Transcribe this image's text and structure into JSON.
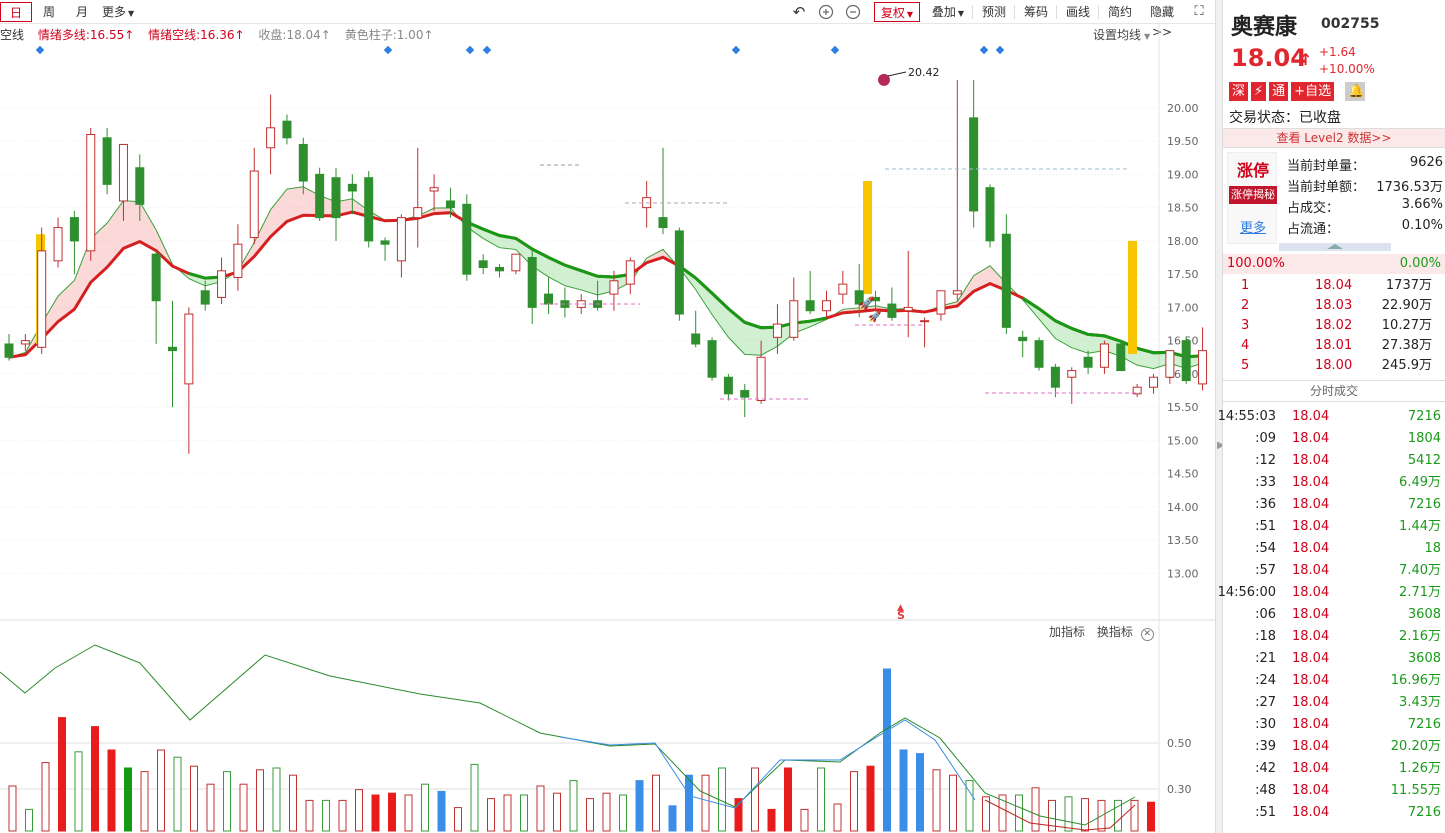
{
  "toolbar": {
    "period_tabs": [
      "日",
      "周",
      "月"
    ],
    "more_label": "更多",
    "right_items": [
      {
        "label": "复权",
        "dropdown": true,
        "highlight": true
      },
      {
        "label": "叠加",
        "dropdown": true
      },
      {
        "label": "预测"
      },
      {
        "label": "筹码"
      },
      {
        "label": "画线"
      },
      {
        "label": "简约"
      },
      {
        "label": "隐藏>>"
      }
    ],
    "icons": [
      "undo-icon",
      "zoom-in-icon",
      "zoom-out-icon",
      "fullscreen-icon"
    ]
  },
  "indicator_header": {
    "items": [
      {
        "text": "空线",
        "color": "#333333"
      },
      {
        "text": "情绪多线:16.55↑",
        "color": "#d0021b"
      },
      {
        "text": "情绪空线:16.36↑",
        "color": "#d0021b"
      },
      {
        "text": "收盘:18.04↑",
        "color": "#888888"
      },
      {
        "text": "黄色柱子:1.00↑",
        "color": "#888888"
      }
    ],
    "set_ma_label": "设置均线"
  },
  "sub_panel": {
    "add_indicator": "加指标",
    "switch_indicator": "换指标"
  },
  "stock": {
    "name": "奥赛康",
    "code": "002755",
    "price": "18.04",
    "change": "+1.64",
    "change_pct": "+10.00%",
    "badges": [
      "深",
      "⚡",
      "通",
      "+自选"
    ],
    "trade_state": "交易状态：已收盘",
    "level2": "查看 Level2 数据>>"
  },
  "limit_up": {
    "title": "涨停",
    "tag": "涨停揭秘",
    "more": "更多",
    "rows": [
      {
        "label": "当前封单量：",
        "value": "9626"
      },
      {
        "label": "当前封单额：",
        "value": "1736.53万"
      },
      {
        "label": "占成交：",
        "value": "3.66%"
      },
      {
        "label": "占流通：",
        "value": "0.10%"
      }
    ]
  },
  "order_book": {
    "left_pct": "100.00%",
    "right_pct": "0.00%",
    "levels": [
      {
        "level": "1",
        "price": "18.04",
        "volume": "1737万"
      },
      {
        "level": "2",
        "price": "18.03",
        "volume": "22.90万"
      },
      {
        "level": "3",
        "price": "18.02",
        "volume": "10.27万"
      },
      {
        "level": "4",
        "price": "18.01",
        "volume": "27.38万"
      },
      {
        "level": "5",
        "price": "18.00",
        "volume": "245.9万"
      }
    ]
  },
  "ticks": {
    "title": "分时成交",
    "rows": [
      {
        "time": "14:55:03",
        "price": "18.04",
        "volume": "7216"
      },
      {
        "time": ":09",
        "price": "18.04",
        "volume": "1804"
      },
      {
        "time": ":12",
        "price": "18.04",
        "volume": "5412"
      },
      {
        "time": ":33",
        "price": "18.04",
        "volume": "6.49万"
      },
      {
        "time": ":36",
        "price": "18.04",
        "volume": "7216"
      },
      {
        "time": ":51",
        "price": "18.04",
        "volume": "1.44万"
      },
      {
        "time": ":54",
        "price": "18.04",
        "volume": "18"
      },
      {
        "time": ":57",
        "price": "18.04",
        "volume": "7.40万"
      },
      {
        "time": "14:56:00",
        "price": "18.04",
        "volume": "2.71万"
      },
      {
        "time": ":06",
        "price": "18.04",
        "volume": "3608"
      },
      {
        "time": ":18",
        "price": "18.04",
        "volume": "2.16万"
      },
      {
        "time": ":21",
        "price": "18.04",
        "volume": "3608"
      },
      {
        "time": ":24",
        "price": "18.04",
        "volume": "16.96万"
      },
      {
        "time": ":27",
        "price": "18.04",
        "volume": "3.43万"
      },
      {
        "time": ":30",
        "price": "18.04",
        "volume": "7216"
      },
      {
        "time": ":39",
        "price": "18.04",
        "volume": "20.20万"
      },
      {
        "time": ":42",
        "price": "18.04",
        "volume": "1.26万"
      },
      {
        "time": ":48",
        "price": "18.04",
        "volume": "11.55万"
      },
      {
        "time": ":51",
        "price": "18.04",
        "volume": "7216"
      }
    ]
  },
  "chart_data": {
    "type": "candlestick",
    "y_axis_ticks": [
      "20.00",
      "19.50",
      "19.00",
      "18.50",
      "18.00",
      "17.50",
      "17.00",
      "16.50",
      "16.00",
      "15.50",
      "15.00",
      "14.50",
      "14.00",
      "13.50",
      "13.00"
    ],
    "y_axis_values": [
      20.0,
      19.5,
      19.0,
      18.5,
      18.0,
      17.5,
      17.0,
      16.5,
      16.0,
      15.5,
      15.0,
      14.5,
      14.0,
      13.5,
      13.0
    ],
    "ylim": [
      12.3,
      20.9
    ],
    "high_annotation": "20.42",
    "high_value": 20.42,
    "sell_marker": "S",
    "candles": [
      {
        "o": 16.45,
        "h": 16.6,
        "c": 16.25,
        "l": 16.2
      },
      {
        "o": 16.45,
        "h": 16.6,
        "c": 16.5,
        "l": 16.35
      },
      {
        "o": 16.4,
        "h": 18.2,
        "c": 17.85,
        "l": 16.3
      },
      {
        "o": 17.7,
        "h": 18.35,
        "c": 18.2,
        "l": 17.6
      },
      {
        "o": 18.35,
        "h": 18.45,
        "c": 18.0,
        "l": 17.5
      },
      {
        "o": 17.85,
        "h": 19.7,
        "c": 19.6,
        "l": 17.7
      },
      {
        "o": 19.55,
        "h": 19.7,
        "c": 18.85,
        "l": 18.7
      },
      {
        "o": 18.6,
        "h": 19.45,
        "c": 19.45,
        "l": 18.3
      },
      {
        "o": 19.1,
        "h": 19.3,
        "c": 18.55,
        "l": 18.3
      },
      {
        "o": 17.8,
        "h": 17.85,
        "c": 17.1,
        "l": 16.45
      },
      {
        "o": 16.4,
        "h": 17.1,
        "c": 16.35,
        "l": 15.5
      },
      {
        "o": 15.85,
        "h": 17.0,
        "c": 16.9,
        "l": 14.8
      },
      {
        "o": 17.25,
        "h": 17.4,
        "c": 17.05,
        "l": 16.95
      },
      {
        "o": 17.15,
        "h": 17.75,
        "c": 17.55,
        "l": 17.05
      },
      {
        "o": 17.45,
        "h": 18.25,
        "c": 17.95,
        "l": 17.25
      },
      {
        "o": 18.05,
        "h": 19.4,
        "c": 19.05,
        "l": 17.95
      },
      {
        "o": 19.4,
        "h": 20.2,
        "c": 19.7,
        "l": 19.0
      },
      {
        "o": 19.8,
        "h": 19.9,
        "c": 19.55,
        "l": 19.45
      },
      {
        "o": 19.45,
        "h": 19.55,
        "c": 18.9,
        "l": 18.7
      },
      {
        "o": 19.0,
        "h": 19.1,
        "c": 18.35,
        "l": 18.3
      },
      {
        "o": 18.95,
        "h": 19.1,
        "c": 18.35,
        "l": 18.0
      },
      {
        "o": 18.85,
        "h": 19.0,
        "c": 18.75,
        "l": 18.4
      },
      {
        "o": 18.95,
        "h": 19.05,
        "c": 18.0,
        "l": 17.9
      },
      {
        "o": 18.0,
        "h": 18.05,
        "c": 17.95,
        "l": 17.7
      },
      {
        "o": 17.7,
        "h": 18.4,
        "c": 18.35,
        "l": 17.45
      },
      {
        "o": 18.35,
        "h": 19.4,
        "c": 18.5,
        "l": 17.9
      },
      {
        "o": 18.75,
        "h": 19.0,
        "c": 18.8,
        "l": 18.45
      },
      {
        "o": 18.6,
        "h": 18.8,
        "c": 18.5,
        "l": 18.35
      },
      {
        "o": 18.55,
        "h": 18.7,
        "c": 17.5,
        "l": 17.4
      },
      {
        "o": 17.7,
        "h": 17.8,
        "c": 17.6,
        "l": 17.5
      },
      {
        "o": 17.6,
        "h": 17.65,
        "c": 17.55,
        "l": 17.45
      },
      {
        "o": 17.55,
        "h": 17.75,
        "c": 17.8,
        "l": 17.5
      },
      {
        "o": 17.75,
        "h": 17.85,
        "c": 17.0,
        "l": 16.75
      },
      {
        "o": 17.2,
        "h": 17.45,
        "c": 17.05,
        "l": 16.9
      },
      {
        "o": 17.1,
        "h": 17.3,
        "c": 17.0,
        "l": 16.85
      },
      {
        "o": 17.0,
        "h": 17.2,
        "c": 17.1,
        "l": 16.9
      },
      {
        "o": 17.1,
        "h": 17.4,
        "c": 17.0,
        "l": 16.95
      },
      {
        "o": 17.2,
        "h": 17.55,
        "c": 17.4,
        "l": 16.95
      },
      {
        "o": 17.35,
        "h": 17.75,
        "c": 17.7,
        "l": 17.2
      },
      {
        "o": 18.5,
        "h": 18.9,
        "c": 18.65,
        "l": 18.2
      },
      {
        "o": 18.35,
        "h": 19.4,
        "c": 18.2,
        "l": 18.1
      },
      {
        "o": 18.15,
        "h": 18.2,
        "c": 16.9,
        "l": 16.8
      },
      {
        "o": 16.6,
        "h": 16.95,
        "c": 16.45,
        "l": 16.4
      },
      {
        "o": 16.5,
        "h": 16.55,
        "c": 15.95,
        "l": 15.9
      },
      {
        "o": 15.95,
        "h": 16.0,
        "c": 15.7,
        "l": 15.6
      },
      {
        "o": 15.75,
        "h": 15.85,
        "c": 15.65,
        "l": 15.35
      },
      {
        "o": 15.6,
        "h": 16.5,
        "c": 16.25,
        "l": 15.55
      },
      {
        "o": 16.55,
        "h": 17.05,
        "c": 16.75,
        "l": 16.3
      },
      {
        "o": 16.55,
        "h": 17.45,
        "c": 17.1,
        "l": 16.5
      },
      {
        "o": 17.1,
        "h": 17.55,
        "c": 16.95,
        "l": 16.9
      },
      {
        "o": 16.95,
        "h": 17.25,
        "c": 17.1,
        "l": 16.85
      },
      {
        "o": 17.2,
        "h": 17.55,
        "c": 17.35,
        "l": 17.05
      },
      {
        "o": 17.25,
        "h": 17.65,
        "c": 17.05,
        "l": 16.85
      },
      {
        "o": 17.15,
        "h": 17.25,
        "c": 17.1,
        "l": 16.95
      },
      {
        "o": 17.05,
        "h": 17.3,
        "c": 16.85,
        "l": 16.8
      },
      {
        "o": 16.95,
        "h": 17.85,
        "c": 17.0,
        "l": 16.55
      },
      {
        "o": 16.8,
        "h": 16.85,
        "c": 16.8,
        "l": 16.4
      },
      {
        "o": 16.9,
        "h": 17.1,
        "c": 17.25,
        "l": 16.8
      },
      {
        "o": 17.2,
        "h": 20.42,
        "c": 17.25,
        "l": 17.1
      },
      {
        "o": 19.85,
        "h": 20.42,
        "c": 18.45,
        "l": 18.2
      },
      {
        "o": 18.8,
        "h": 18.85,
        "c": 18.0,
        "l": 17.9
      },
      {
        "o": 18.1,
        "h": 18.4,
        "c": 16.7,
        "l": 16.6
      },
      {
        "o": 16.55,
        "h": 16.65,
        "c": 16.5,
        "l": 16.25
      },
      {
        "o": 16.5,
        "h": 16.55,
        "c": 16.1,
        "l": 16.05
      },
      {
        "o": 16.1,
        "h": 16.15,
        "c": 15.8,
        "l": 15.65
      },
      {
        "o": 15.95,
        "h": 16.1,
        "c": 16.05,
        "l": 15.55
      },
      {
        "o": 16.25,
        "h": 16.35,
        "c": 16.1,
        "l": 16.0
      },
      {
        "o": 16.1,
        "h": 16.5,
        "c": 16.45,
        "l": 16.0
      },
      {
        "o": 16.45,
        "h": 16.5,
        "c": 16.05,
        "l": 16.05
      },
      {
        "o": 15.7,
        "h": 15.85,
        "c": 15.8,
        "l": 15.65
      },
      {
        "o": 15.8,
        "h": 16.0,
        "c": 15.95,
        "l": 15.7
      },
      {
        "o": 15.95,
        "h": 16.3,
        "c": 16.35,
        "l": 15.85
      },
      {
        "o": 16.5,
        "h": 16.55,
        "c": 15.9,
        "l": 15.85
      },
      {
        "o": 15.85,
        "h": 16.7,
        "c": 16.35,
        "l": 15.75
      }
    ]
  }
}
